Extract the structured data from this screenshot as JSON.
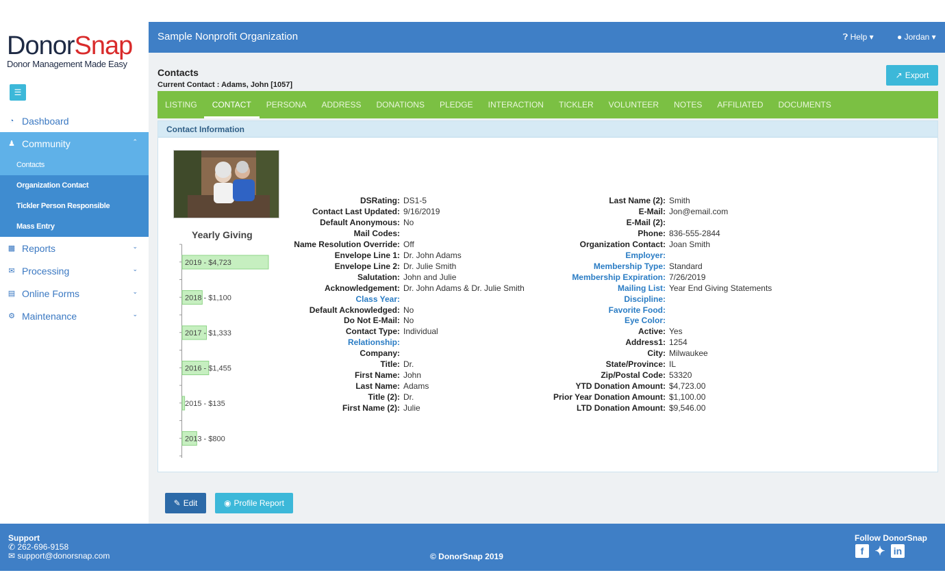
{
  "logo": {
    "brand_a": "Donor",
    "brand_b": "Snap",
    "tagline": "Donor Management Made Easy"
  },
  "sidebar": {
    "items": [
      {
        "label": "Dashboard",
        "icon": "dashboard-icon"
      },
      {
        "label": "Community",
        "icon": "users-icon",
        "active": true
      },
      {
        "label": "Reports",
        "icon": "bar-chart-icon"
      },
      {
        "label": "Processing",
        "icon": "envelope-icon"
      },
      {
        "label": "Online Forms",
        "icon": "list-icon"
      },
      {
        "label": "Maintenance",
        "icon": "gear-icon"
      }
    ],
    "sub_items": [
      "Contacts",
      "Organization Contact",
      "Tickler Person Responsible",
      "Mass Entry"
    ]
  },
  "topbar": {
    "org": "Sample Nonprofit Organization",
    "help": "Help",
    "user": "Jordan"
  },
  "page": {
    "title": "Contacts",
    "current_contact": "Current Contact : Adams, John [1057]",
    "export": "Export"
  },
  "tabs": [
    "LISTING",
    "CONTACT",
    "PERSONA",
    "ADDRESS",
    "DONATIONS",
    "PLEDGE",
    "INTERACTION",
    "TICKLER",
    "VOLUNTEER",
    "NOTES",
    "AFFILIATED",
    "DOCUMENTS"
  ],
  "active_tab": "CONTACT",
  "panel": {
    "heading": "Contact Information",
    "yearly_giving_title": "Yearly Giving"
  },
  "yearly_giving": [
    {
      "label": "2019 - $4,723",
      "amount": 4723
    },
    {
      "label": "2018 - $1,100",
      "amount": 1100
    },
    {
      "label": "2017 - $1,333",
      "amount": 1333
    },
    {
      "label": "2016 - $1,455",
      "amount": 1455
    },
    {
      "label": "2015 - $135",
      "amount": 135
    },
    {
      "label": "2013 - $800",
      "amount": 800
    }
  ],
  "fields_left": [
    {
      "label": "DSRating:",
      "value": "DS1-5"
    },
    {
      "label": "Contact Last Updated:",
      "value": "9/16/2019"
    },
    {
      "label": "Default Anonymous:",
      "value": "No"
    },
    {
      "label": "Mail Codes:",
      "value": ""
    },
    {
      "label": "Name Resolution Override:",
      "value": "Off"
    },
    {
      "label": "Envelope Line 1:",
      "value": "Dr. John Adams"
    },
    {
      "label": "Envelope Line 2:",
      "value": "Dr. Julie Smith"
    },
    {
      "label": "Salutation:",
      "value": "John and Julie"
    },
    {
      "label": "Acknowledgement:",
      "value": "Dr. John Adams & Dr. Julie Smith"
    },
    {
      "label": "Class Year:",
      "value": "",
      "link": true
    },
    {
      "label": "Default Acknowledged:",
      "value": "No"
    },
    {
      "label": "Do Not E-Mail:",
      "value": "No"
    },
    {
      "label": "Contact Type:",
      "value": "Individual"
    },
    {
      "label": "Relationship:",
      "value": "",
      "link": true
    },
    {
      "label": "Company:",
      "value": ""
    },
    {
      "label": "Title:",
      "value": "Dr."
    },
    {
      "label": "First Name:",
      "value": "John"
    },
    {
      "label": "Last Name:",
      "value": "Adams"
    },
    {
      "label": "Title (2):",
      "value": "Dr."
    },
    {
      "label": "First Name (2):",
      "value": "Julie"
    }
  ],
  "fields_right": [
    {
      "label": "Last Name (2):",
      "value": "Smith"
    },
    {
      "label": "E-Mail:",
      "value": "Jon@email.com"
    },
    {
      "label": "E-Mail (2):",
      "value": ""
    },
    {
      "label": "Phone:",
      "value": "836-555-2844"
    },
    {
      "label": "Organization Contact:",
      "value": "Joan Smith"
    },
    {
      "label": "Employer:",
      "value": "",
      "link": true
    },
    {
      "label": "Membership Type:",
      "value": "Standard",
      "link": true
    },
    {
      "label": "Membership Expiration:",
      "value": "7/26/2019",
      "link": true
    },
    {
      "label": "Mailing List:",
      "value": "Year End Giving Statements",
      "link": true
    },
    {
      "label": "Discipline:",
      "value": "",
      "link": true
    },
    {
      "label": "Favorite Food:",
      "value": "",
      "link": true
    },
    {
      "label": "Eye Color:",
      "value": "",
      "link": true
    },
    {
      "label": "Active:",
      "value": "Yes"
    },
    {
      "label": "Address1:",
      "value": "1254"
    },
    {
      "label": "City:",
      "value": "Milwaukee"
    },
    {
      "label": "State/Province:",
      "value": "IL"
    },
    {
      "label": "Zip/Postal Code:",
      "value": "53320"
    },
    {
      "label": "YTD Donation Amount:",
      "value": "$4,723.00"
    },
    {
      "label": "Prior Year Donation Amount:",
      "value": "$1,100.00"
    },
    {
      "label": "LTD Donation Amount:",
      "value": "$9,546.00"
    }
  ],
  "buttons": {
    "edit": "Edit",
    "profile_report": "Profile Report"
  },
  "footer": {
    "support_title": "Support",
    "phone": "262-696-9158",
    "email": "support@donorsnap.com",
    "copyright": "© DonorSnap 2019",
    "follow": "Follow DonorSnap",
    "socials": [
      "facebook-icon",
      "twitter-icon",
      "linkedin-icon"
    ]
  },
  "colors": {
    "primary": "#3f7fc6",
    "accent": "#3cb8d9",
    "tabs": "#7bc043",
    "bar_fill": "#c6efc0",
    "bar_stroke": "#8fd488"
  }
}
